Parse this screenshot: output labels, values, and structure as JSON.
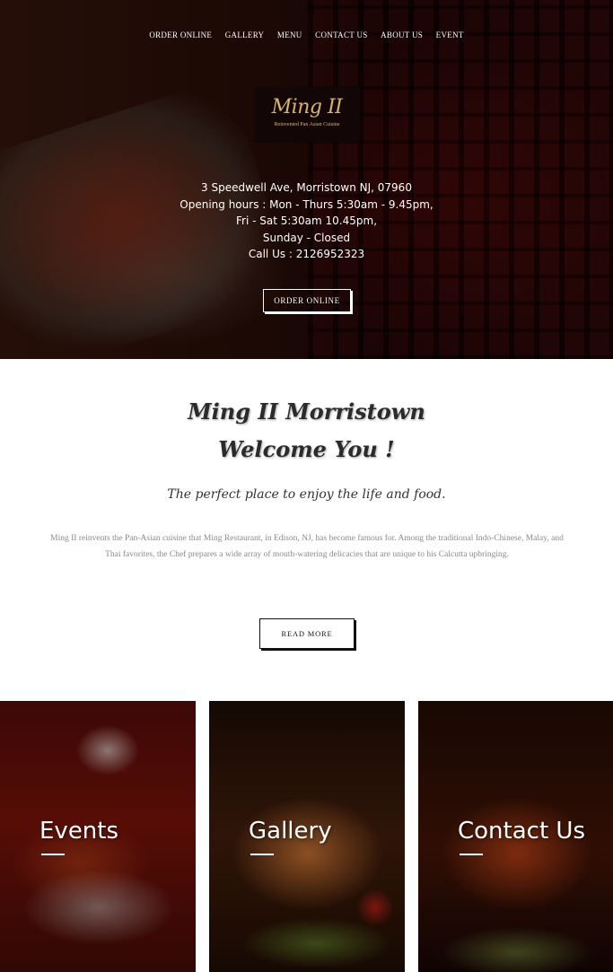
{
  "nav": {
    "items": [
      "ORDER ONLINE",
      "GALLERY",
      "MENU",
      "CONTACT US",
      "ABOUT US",
      "EVENT"
    ]
  },
  "logo": {
    "name": "Ming II",
    "tagline": "Reinvented Pan Asian Cuisine"
  },
  "hero": {
    "address": "3 Speedwell Ave, Morristown NJ, 07960",
    "hours_1": "Opening hours : Mon - Thurs 5:30am - 9.45pm,",
    "hours_2": "Fri - Sat 5:30am 10.45pm,",
    "hours_3": "Sunday - Closed",
    "phone": "Call Us : 2126952323",
    "order_button": "ORDER ONLINE"
  },
  "welcome": {
    "title_1": "Ming II Morristown",
    "title_2": "Welcome You !",
    "tagline": "The perfect place to enjoy the life and food.",
    "body": "Ming II reinvents the Pan-Asian cuisine that Ming Restaurant, in Edison, NJ, has become famous for. Among the traditional Indo-Chinese, Malay, and Thai favorites, the Chef prepares a wide array of mouth-watering delicacies that are unique to his Calcutta upbringing.",
    "read_more": "READ MORE"
  },
  "cards": [
    {
      "title": "Events"
    },
    {
      "title": "Gallery"
    },
    {
      "title": "Contact Us"
    }
  ]
}
